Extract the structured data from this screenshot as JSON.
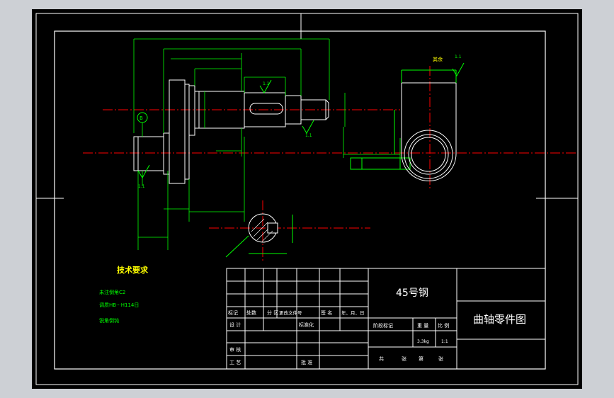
{
  "colors": {
    "frame": "#ffffff",
    "geometry": "#ffffff",
    "dimension": "#00ff00",
    "centerline": "#ff0000",
    "tech_title": "#ffff00",
    "tech_items": "#00ff00",
    "background": "#000000",
    "viewport_bg": "#cdd0d5"
  },
  "drawing": {
    "material": "45号钢",
    "title": "曲轴零件图",
    "dims": {
      "tol_1": "1.1",
      "tol_2": "1.1",
      "tol_3": "1.1",
      "tol_4": "1.1",
      "surface_note": "其余",
      "datum": "B"
    }
  },
  "tech_requirements": {
    "heading": "技术要求",
    "items": [
      "未注倒角C2",
      "调质HB···H114日",
      "锐角倒钝"
    ]
  },
  "title_block": {
    "headers": [
      "标记",
      "处数",
      "分 区",
      "更改文件号",
      "签 名",
      "年、月、日"
    ],
    "row_design": "设 计",
    "row_standard": "标准化",
    "row_review": "审 核",
    "row_process": "工 艺",
    "row_approve": "批 准",
    "stage_label": "阶段标记",
    "weight_label": "重 量",
    "scale_label": "比 例",
    "weight_value": "3.3kg",
    "scale_value": "1:1",
    "sheets_total": "共",
    "sheets_unit": "张",
    "sheet_no": "第",
    "sheet_unit2": "张"
  }
}
